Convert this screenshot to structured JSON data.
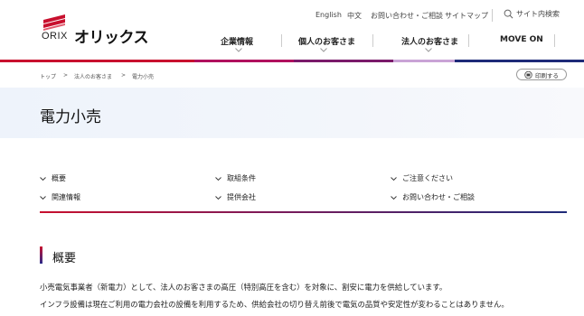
{
  "header": {
    "logo_text": "ORIX",
    "logo_jp": "オリックス",
    "util_links": [
      "English",
      "中文",
      "お問い合わせ・ご相談",
      "サイトマップ"
    ],
    "search_label": "サイト内検索",
    "nav": [
      "企業情報",
      "個人のお客さま",
      "法人のお客さま",
      "MOVE ON"
    ]
  },
  "breadcrumb": [
    "トップ",
    "法人のお客さま",
    "電力小売"
  ],
  "breadcrumb_sep": ">",
  "print_label": "印刷する",
  "page_title": "電力小売",
  "anchors": [
    "概要",
    "取組条件",
    "ご注意ください",
    "関連情報",
    "提供会社",
    "お問い合わせ・ご相談"
  ],
  "section": {
    "title": "概要",
    "paragraphs": [
      "小売電気事業者（新電力）として、法人のお客さまの高圧（特別高圧を含む）を対象に、割安に電力を供給しています。",
      "インフラ設備は現在ご利用の電力会社の設備を利用するため、供給会社の切り替え前後で電気の品質や安定性が変わることはありません。"
    ]
  },
  "colors": {
    "brand_red": "#c8102e",
    "brand_navy": "#1e2a78",
    "title_band": "#eef3fb"
  },
  "icons": [
    "orix-logo-mark",
    "search-icon",
    "printer-icon",
    "chevron-down-icon"
  ]
}
